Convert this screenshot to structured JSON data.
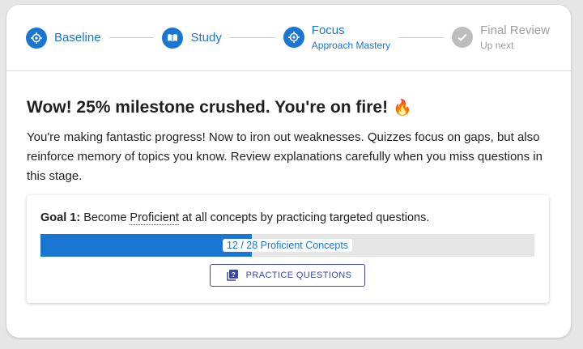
{
  "stepper": {
    "steps": [
      {
        "label": "Baseline",
        "icon": "crosshair-icon"
      },
      {
        "label": "Study",
        "icon": "book-icon"
      },
      {
        "label": "Focus",
        "sublabel": "Approach Mastery",
        "icon": "target-icon"
      },
      {
        "label": "Final Review",
        "sublabel": "Up next",
        "icon": "check-icon"
      }
    ],
    "active_color": "#1976d2",
    "inactive_color": "#9e9e9e"
  },
  "main": {
    "heading": "Wow! 25% milestone crushed. You're on fire!",
    "heading_emoji": "🔥",
    "description": "You're making fantastic progress! Now to iron out weaknesses. Quizzes focus on gaps, but also reinforce memory of topics you know. Review explanations carefully when you miss questions in this stage."
  },
  "goal": {
    "label": "Goal 1:",
    "text_before": "Become",
    "term": "Proficient",
    "text_after": "at all concepts by practicing targeted questions.",
    "progress_current": 12,
    "progress_total": 28,
    "progress_text": "12 / 28 Proficient Concepts",
    "button_label": "PRACTICE QUESTIONS",
    "button_icon": "quiz-icon"
  }
}
